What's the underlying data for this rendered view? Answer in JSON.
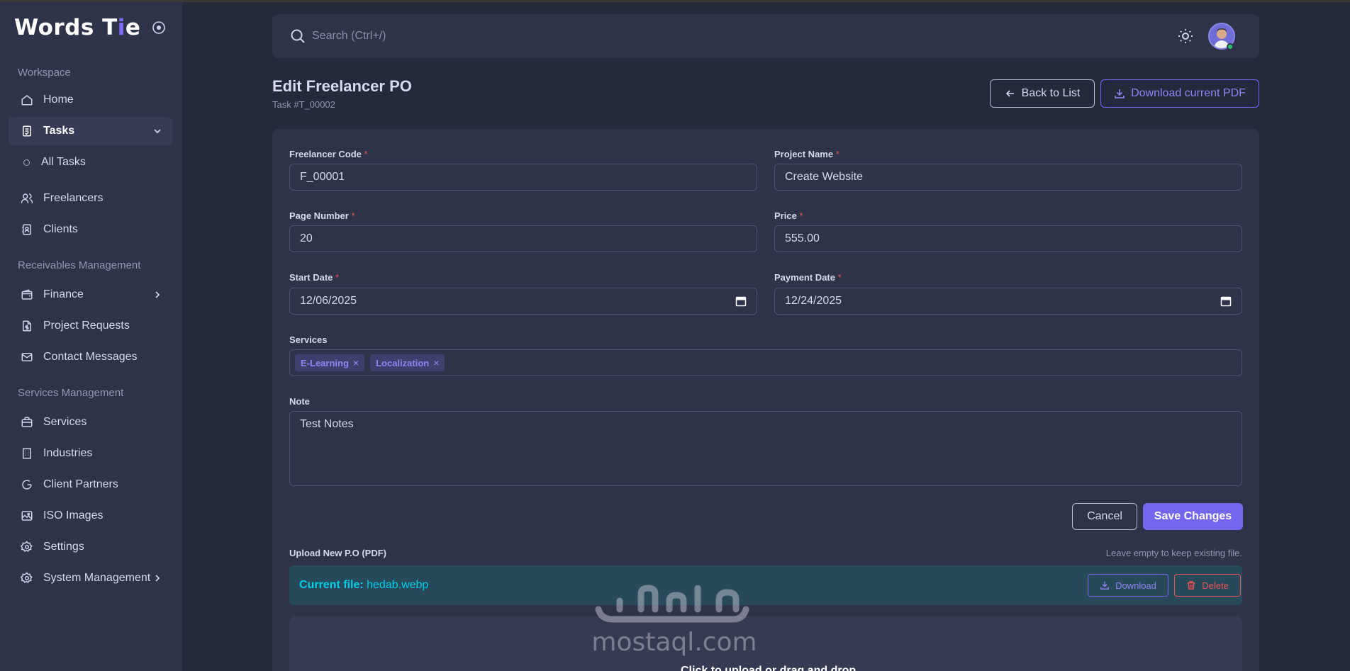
{
  "brand": {
    "name_part1": "Words T",
    "name_accent": "i",
    "name_part2": "e"
  },
  "sidebar": {
    "sections": [
      "Workspace",
      "Receivables Management",
      "Services Management"
    ],
    "items": [
      {
        "label": "Home",
        "icon": "home-icon"
      },
      {
        "label": "Tasks",
        "icon": "tasks-icon",
        "active": true
      },
      {
        "label": "All Tasks",
        "icon": "circle-icon"
      },
      {
        "label": "Freelancers",
        "icon": "users-icon"
      },
      {
        "label": "Clients",
        "icon": "contacts-icon"
      },
      {
        "label": "Finance",
        "icon": "wallet-icon"
      },
      {
        "label": "Project Requests",
        "icon": "file-dollar-icon"
      },
      {
        "label": "Contact Messages",
        "icon": "mail-icon"
      },
      {
        "label": "Services",
        "icon": "briefcase-icon"
      },
      {
        "label": "Industries",
        "icon": "building-icon"
      },
      {
        "label": "Client Partners",
        "icon": "partner-icon"
      },
      {
        "label": "ISO Images",
        "icon": "image-icon"
      },
      {
        "label": "Settings",
        "icon": "gear-icon"
      },
      {
        "label": "System Management",
        "icon": "gear-icon"
      }
    ]
  },
  "topbar": {
    "search_placeholder": "Search (Ctrl+/)"
  },
  "page": {
    "title": "Edit Freelancer PO",
    "subtitle": "Task #T_00002",
    "back_label": "Back to List",
    "download_pdf_label": "Download current PDF"
  },
  "form": {
    "freelancer_code": {
      "label": "Freelancer Code",
      "value": "F_00001"
    },
    "project_name": {
      "label": "Project Name",
      "value": "Create Website"
    },
    "page_number": {
      "label": "Page Number",
      "value": "20"
    },
    "price": {
      "label": "Price",
      "value": "555.00"
    },
    "start_date": {
      "label": "Start Date",
      "value": "12/06/2025"
    },
    "payment_date": {
      "label": "Payment Date",
      "value": "12/24/2025"
    },
    "services": {
      "label": "Services",
      "chips": [
        "E-Learning",
        "Localization"
      ]
    },
    "note": {
      "label": "Note",
      "value": "Test Notes"
    },
    "required_mark": "*",
    "chip_remove": "×"
  },
  "actions": {
    "cancel_label": "Cancel",
    "save_label": "Save Changes"
  },
  "upload": {
    "label": "Upload New P.O (PDF)",
    "hint": "Leave empty to keep existing file.",
    "current_file_prefix": "Current file:",
    "current_file_name": "hedab.webp",
    "download_label": "Download",
    "delete_label": "Delete",
    "dropzone_text": "Click to upload or drag and drop"
  },
  "watermark": {
    "latin": "mostaql.com",
    "arabic": "مستقل"
  },
  "colors": {
    "accent": "#7367f0",
    "danger": "#ea5455",
    "info": "#00cfe8",
    "bg": "#25293c",
    "panel": "#2f3349"
  }
}
